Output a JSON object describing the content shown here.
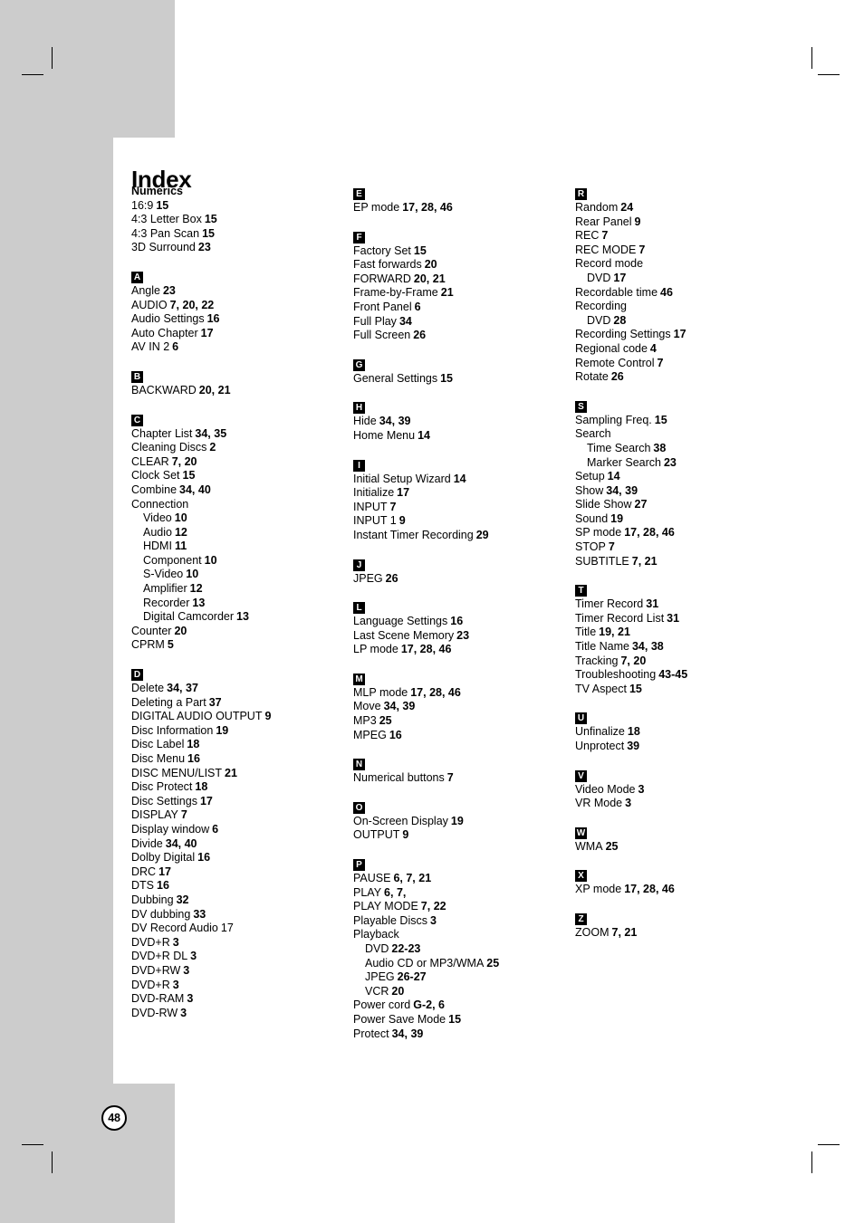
{
  "page": {
    "title": "Index",
    "number": "48"
  },
  "columns": [
    {
      "groups": [
        {
          "head": "Numerics",
          "head_style": "plain",
          "entries": [
            {
              "term": "16:9",
              "pages": "15"
            },
            {
              "term": "4:3 Letter Box",
              "pages": "15"
            },
            {
              "term": "4:3 Pan Scan",
              "pages": "15"
            },
            {
              "term": "3D Surround",
              "pages": "23"
            }
          ]
        },
        {
          "head": "A",
          "head_style": "badge",
          "entries": [
            {
              "term": "Angle",
              "pages": "23"
            },
            {
              "term": "AUDIO",
              "pages": "7, 20, 22"
            },
            {
              "term": "Audio Settings",
              "pages": "16"
            },
            {
              "term": "Auto Chapter",
              "pages": "17"
            },
            {
              "term": "AV IN 2",
              "pages": "6"
            }
          ]
        },
        {
          "head": "B",
          "head_style": "badge",
          "entries": [
            {
              "term": "BACKWARD",
              "pages": "20, 21"
            }
          ]
        },
        {
          "head": "C",
          "head_style": "badge",
          "entries": [
            {
              "term": "Chapter List",
              "pages": "34, 35"
            },
            {
              "term": "Cleaning Discs",
              "pages": "2"
            },
            {
              "term": "CLEAR",
              "pages": "7, 20"
            },
            {
              "term": "Clock Set",
              "pages": "15"
            },
            {
              "term": "Combine",
              "pages": "34, 40"
            },
            {
              "term": "Connection",
              "pages": ""
            },
            {
              "term": "Video",
              "pages": "10",
              "sub": true
            },
            {
              "term": "Audio",
              "pages": "12",
              "sub": true
            },
            {
              "term": "HDMI",
              "pages": "11",
              "sub": true
            },
            {
              "term": "Component",
              "pages": "10",
              "sub": true
            },
            {
              "term": "S-Video",
              "pages": "10",
              "sub": true
            },
            {
              "term": "Amplifier",
              "pages": "12",
              "sub": true
            },
            {
              "term": "Recorder",
              "pages": "13",
              "sub": true
            },
            {
              "term": "Digital Camcorder",
              "pages": "13",
              "sub": true
            },
            {
              "term": "Counter",
              "pages": "20"
            },
            {
              "term": "CPRM",
              "pages": "5"
            }
          ]
        },
        {
          "head": "D",
          "head_style": "badge",
          "entries": [
            {
              "term": "Delete",
              "pages": "34, 37"
            },
            {
              "term": "Deleting a Part",
              "pages": "37"
            },
            {
              "term": "DIGITAL AUDIO OUTPUT",
              "pages": "9"
            },
            {
              "term": "Disc Information",
              "pages": "19"
            },
            {
              "term": "Disc Label",
              "pages": "18"
            },
            {
              "term": "Disc Menu",
              "pages": "16"
            },
            {
              "term": "DISC MENU/LIST",
              "pages": "21"
            },
            {
              "term": "Disc Protect",
              "pages": "18"
            },
            {
              "term": "Disc Settings",
              "pages": "17"
            },
            {
              "term": "DISPLAY",
              "pages": "7"
            },
            {
              "term": "Display window",
              "pages": "6"
            },
            {
              "term": "Divide",
              "pages": "34, 40"
            },
            {
              "term": "Dolby Digital",
              "pages": "16"
            },
            {
              "term": "DRC",
              "pages": "17"
            },
            {
              "term": "DTS",
              "pages": "16"
            },
            {
              "term": "Dubbing",
              "pages": "32"
            },
            {
              "term": "DV dubbing",
              "pages": "33"
            },
            {
              "term": "DV Record Audio",
              "pages": "17",
              "plain_pages": true
            },
            {
              "term": "DVD+R",
              "pages": "3"
            },
            {
              "term": "DVD+R DL",
              "pages": "3"
            },
            {
              "term": "DVD+RW",
              "pages": "3"
            },
            {
              "term": "DVD+R",
              "pages": "3"
            },
            {
              "term": "DVD-RAM",
              "pages": "3"
            },
            {
              "term": "DVD-RW",
              "pages": "3"
            }
          ]
        }
      ]
    },
    {
      "groups": [
        {
          "head": "E",
          "head_style": "badge",
          "entries": [
            {
              "term": "EP mode",
              "pages": "17, 28, 46"
            }
          ]
        },
        {
          "head": "F",
          "head_style": "badge",
          "entries": [
            {
              "term": "Factory Set",
              "pages": "15"
            },
            {
              "term": "Fast forwards",
              "pages": "20"
            },
            {
              "term": "FORWARD",
              "pages": "20, 21"
            },
            {
              "term": "Frame-by-Frame",
              "pages": "21"
            },
            {
              "term": "Front Panel",
              "pages": "6"
            },
            {
              "term": "Full Play",
              "pages": "34"
            },
            {
              "term": "Full Screen",
              "pages": "26"
            }
          ]
        },
        {
          "head": "G",
          "head_style": "badge",
          "entries": [
            {
              "term": "General Settings",
              "pages": "15"
            }
          ]
        },
        {
          "head": "H",
          "head_style": "badge",
          "entries": [
            {
              "term": "Hide",
              "pages": "34, 39"
            },
            {
              "term": "Home Menu",
              "pages": "14"
            }
          ]
        },
        {
          "head": "I",
          "head_style": "badge",
          "entries": [
            {
              "term": "Initial Setup Wizard",
              "pages": "14"
            },
            {
              "term": "Initialize",
              "pages": "17"
            },
            {
              "term": "INPUT",
              "pages": "7"
            },
            {
              "term": "INPUT 1",
              "pages": "9"
            },
            {
              "term": "Instant Timer Recording",
              "pages": "29"
            }
          ]
        },
        {
          "head": "J",
          "head_style": "badge",
          "entries": [
            {
              "term": "JPEG",
              "pages": "26"
            }
          ]
        },
        {
          "head": "L",
          "head_style": "badge",
          "entries": [
            {
              "term": "Language Settings",
              "pages": "16"
            },
            {
              "term": "Last Scene Memory",
              "pages": "23"
            },
            {
              "term": "LP mode",
              "pages": "17, 28, 46"
            }
          ]
        },
        {
          "head": "M",
          "head_style": "badge",
          "entries": [
            {
              "term": "MLP mode",
              "pages": "17, 28, 46"
            },
            {
              "term": "Move",
              "pages": "34, 39"
            },
            {
              "term": "MP3",
              "pages": "25"
            },
            {
              "term": "MPEG",
              "pages": "16"
            }
          ]
        },
        {
          "head": "N",
          "head_style": "badge",
          "entries": [
            {
              "term": "Numerical buttons",
              "pages": "7"
            }
          ]
        },
        {
          "head": "O",
          "head_style": "badge",
          "entries": [
            {
              "term": "On-Screen Display",
              "pages": "19"
            },
            {
              "term": "OUTPUT",
              "pages": "9"
            }
          ]
        },
        {
          "head": "P",
          "head_style": "badge",
          "entries": [
            {
              "term": "PAUSE",
              "pages": "6, 7, 21"
            },
            {
              "term": "PLAY",
              "pages": "6, 7,"
            },
            {
              "term": "PLAY MODE",
              "pages": "7, 22"
            },
            {
              "term": "Playable Discs",
              "pages": "3"
            },
            {
              "term": "Playback",
              "pages": ""
            },
            {
              "term": "DVD",
              "pages": "22-23",
              "sub": true
            },
            {
              "term": "Audio CD or MP3/WMA",
              "pages": "25",
              "sub": true
            },
            {
              "term": "JPEG",
              "pages": "26-27",
              "sub": true
            },
            {
              "term": "VCR",
              "pages": "20",
              "sub": true
            },
            {
              "term": "Power cord",
              "pages": "G-2, 6"
            },
            {
              "term": "Power Save Mode",
              "pages": "15"
            },
            {
              "term": "Protect",
              "pages": "34, 39"
            }
          ]
        }
      ]
    },
    {
      "groups": [
        {
          "head": "R",
          "head_style": "badge",
          "entries": [
            {
              "term": "Random",
              "pages": "24"
            },
            {
              "term": "Rear Panel",
              "pages": "9"
            },
            {
              "term": "REC",
              "pages": "7"
            },
            {
              "term": "REC MODE",
              "pages": "7"
            },
            {
              "term": "Record mode",
              "pages": ""
            },
            {
              "term": "DVD",
              "pages": "17",
              "sub": true
            },
            {
              "term": "Recordable time",
              "pages": "46"
            },
            {
              "term": "Recording",
              "pages": ""
            },
            {
              "term": "DVD",
              "pages": "28",
              "sub": true
            },
            {
              "term": "Recording Settings",
              "pages": "17"
            },
            {
              "term": "Regional code",
              "pages": "4"
            },
            {
              "term": "Remote Control",
              "pages": "7"
            },
            {
              "term": "Rotate",
              "pages": "26"
            }
          ]
        },
        {
          "head": "S",
          "head_style": "badge",
          "entries": [
            {
              "term": "Sampling Freq.",
              "pages": "15"
            },
            {
              "term": "Search",
              "pages": ""
            },
            {
              "term": "Time Search",
              "pages": "38",
              "sub": true
            },
            {
              "term": "Marker Search",
              "pages": "23",
              "sub": true
            },
            {
              "term": "Setup",
              "pages": "14"
            },
            {
              "term": "Show",
              "pages": "34, 39"
            },
            {
              "term": "Slide Show",
              "pages": "27"
            },
            {
              "term": "Sound",
              "pages": "19"
            },
            {
              "term": "SP mode",
              "pages": "17, 28, 46"
            },
            {
              "term": "STOP",
              "pages": "7"
            },
            {
              "term": "SUBTITLE",
              "pages": "7, 21"
            }
          ]
        },
        {
          "head": "T",
          "head_style": "badge",
          "entries": [
            {
              "term": "Timer Record",
              "pages": "31"
            },
            {
              "term": "Timer Record List",
              "pages": "31"
            },
            {
              "term": "Title",
              "pages": "19, 21"
            },
            {
              "term": "Title Name",
              "pages": "34, 38"
            },
            {
              "term": "Tracking",
              "pages": "7, 20"
            },
            {
              "term": "Troubleshooting",
              "pages": "43-45"
            },
            {
              "term": "TV Aspect",
              "pages": "15"
            }
          ]
        },
        {
          "head": "U",
          "head_style": "badge",
          "entries": [
            {
              "term": "Unfinalize",
              "pages": "18"
            },
            {
              "term": "Unprotect",
              "pages": "39"
            }
          ]
        },
        {
          "head": "V",
          "head_style": "badge",
          "entries": [
            {
              "term": "Video Mode",
              "pages": "3"
            },
            {
              "term": "VR Mode",
              "pages": "3"
            }
          ]
        },
        {
          "head": "W",
          "head_style": "badge",
          "entries": [
            {
              "term": "WMA",
              "pages": "25"
            }
          ]
        },
        {
          "head": "X",
          "head_style": "badge",
          "entries": [
            {
              "term": "XP mode",
              "pages": "17, 28, 46"
            }
          ]
        },
        {
          "head": "Z",
          "head_style": "badge",
          "entries": [
            {
              "term": "ZOOM",
              "pages": "7, 21"
            }
          ]
        }
      ]
    }
  ]
}
